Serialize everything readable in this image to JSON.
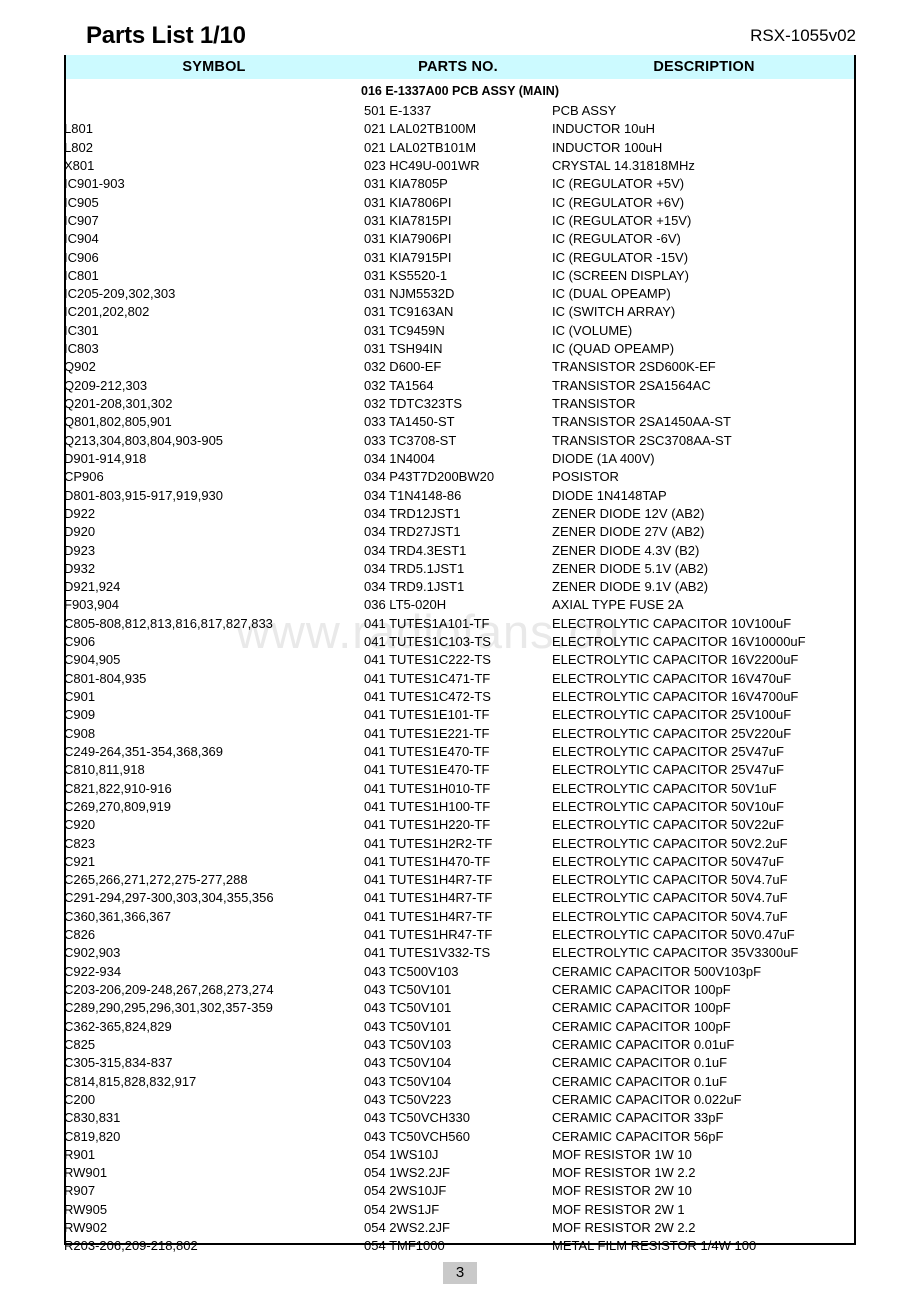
{
  "document": {
    "title": "Parts List 1/10",
    "model": "RSX-1055v02",
    "page_number": "3",
    "watermark": "www.radiofans.cn"
  },
  "table": {
    "columns": [
      "SYMBOL",
      "PARTS NO.",
      "DESCRIPTION"
    ],
    "section_header": "016 E-1337A00 PCB ASSY (MAIN)",
    "rows": [
      {
        "symbol": "",
        "part": "501 E-1337",
        "desc": "PCB ASSY"
      },
      {
        "symbol": "L801",
        "part": "021 LAL02TB100M",
        "desc": "INDUCTOR 10uH"
      },
      {
        "symbol": "L802",
        "part": "021 LAL02TB101M",
        "desc": "INDUCTOR 100uH"
      },
      {
        "symbol": "X801",
        "part": "023 HC49U-001WR",
        "desc": "CRYSTAL 14.31818MHz"
      },
      {
        "symbol": "IC901-903",
        "part": "031 KIA7805P",
        "desc": "IC (REGULATOR    +5V)"
      },
      {
        "symbol": "IC905",
        "part": "031 KIA7806PI",
        "desc": "IC (REGULATOR    +6V)"
      },
      {
        "symbol": "IC907",
        "part": "031 KIA7815PI",
        "desc": "IC (REGULATOR  +15V)"
      },
      {
        "symbol": "IC904",
        "part": "031 KIA7906PI",
        "desc": "IC (REGULATOR    -6V)"
      },
      {
        "symbol": "IC906",
        "part": "031 KIA7915PI",
        "desc": "IC (REGULATOR  -15V)"
      },
      {
        "symbol": "IC801",
        "part": "031 KS5520-1",
        "desc": "IC (SCREEN DISPLAY)"
      },
      {
        "symbol": "IC205-209,302,303",
        "part": "031 NJM5532D",
        "desc": "IC (DUAL OPEAMP)"
      },
      {
        "symbol": "IC201,202,802",
        "part": "031 TC9163AN",
        "desc": "IC (SWITCH ARRAY)"
      },
      {
        "symbol": "IC301",
        "part": "031 TC9459N",
        "desc": "IC (VOLUME)"
      },
      {
        "symbol": "IC803",
        "part": "031 TSH94IN",
        "desc": "IC (QUAD OPEAMP)"
      },
      {
        "symbol": "Q902",
        "part": "032 D600-EF",
        "desc": "TRANSISTOR 2SD600K-EF"
      },
      {
        "symbol": "Q209-212,303",
        "part": "032 TA1564",
        "desc": "TRANSISTOR 2SA1564AC"
      },
      {
        "symbol": "Q201-208,301,302",
        "part": "032 TDTC323TS",
        "desc": "TRANSISTOR"
      },
      {
        "symbol": "Q801,802,805,901",
        "part": "033 TA1450-ST",
        "desc": "TRANSISTOR 2SA1450AA-ST"
      },
      {
        "symbol": "Q213,304,803,804,903-905",
        "part": "033 TC3708-ST",
        "desc": "TRANSISTOR 2SC3708AA-ST"
      },
      {
        "symbol": "D901-914,918",
        "part": "034 1N4004",
        "desc": "DIODE (1A 400V)"
      },
      {
        "symbol": "CP906",
        "part": "034 P43T7D200BW20",
        "desc": "POSISTOR"
      },
      {
        "symbol": "D801-803,915-917,919,930",
        "part": "034 T1N4148-86",
        "desc": "DIODE 1N4148TAP"
      },
      {
        "symbol": "D922",
        "part": "034 TRD12JST1",
        "desc": "ZENER DIODE 12V (AB2)"
      },
      {
        "symbol": "D920",
        "part": "034 TRD27JST1",
        "desc": "ZENER DIODE 27V (AB2)"
      },
      {
        "symbol": "D923",
        "part": "034 TRD4.3EST1",
        "desc": "ZENER DIODE 4.3V  (B2)"
      },
      {
        "symbol": "D932",
        "part": "034 TRD5.1JST1",
        "desc": "ZENER DIODE 5.1V (AB2)"
      },
      {
        "symbol": "D921,924",
        "part": "034 TRD9.1JST1",
        "desc": "ZENER DIODE 9.1V (AB2)"
      },
      {
        "symbol": "F903,904",
        "part": "036 LT5-020H",
        "desc": "AXIAL TYPE FUSE 2A"
      },
      {
        "symbol": "C805-808,812,813,816,817,827,833",
        "part": "041 TUTES1A101-TF",
        "desc": "ELECTROLYTIC CAPACITOR 10V100uF"
      },
      {
        "symbol": "C906",
        "part": "041 TUTES1C103-TS",
        "desc": "ELECTROLYTIC CAPACITOR 16V10000uF"
      },
      {
        "symbol": "C904,905",
        "part": "041 TUTES1C222-TS",
        "desc": "ELECTROLYTIC CAPACITOR 16V2200uF"
      },
      {
        "symbol": "C801-804,935",
        "part": "041 TUTES1C471-TF",
        "desc": "ELECTROLYTIC CAPACITOR 16V470uF"
      },
      {
        "symbol": "C901",
        "part": "041 TUTES1C472-TS",
        "desc": "ELECTROLYTIC CAPACITOR 16V4700uF"
      },
      {
        "symbol": "C909",
        "part": "041 TUTES1E101-TF",
        "desc": "ELECTROLYTIC CAPACITOR 25V100uF"
      },
      {
        "symbol": "C908",
        "part": "041 TUTES1E221-TF",
        "desc": "ELECTROLYTIC CAPACITOR 25V220uF"
      },
      {
        "symbol": "C249-264,351-354,368,369",
        "part": "041 TUTES1E470-TF",
        "desc": "ELECTROLYTIC CAPACITOR 25V47uF"
      },
      {
        "symbol": "C810,811,918",
        "part": "041 TUTES1E470-TF",
        "desc": "ELECTROLYTIC CAPACITOR 25V47uF"
      },
      {
        "symbol": "C821,822,910-916",
        "part": "041 TUTES1H010-TF",
        "desc": "ELECTROLYTIC CAPACITOR 50V1uF"
      },
      {
        "symbol": "C269,270,809,919",
        "part": "041 TUTES1H100-TF",
        "desc": "ELECTROLYTIC CAPACITOR 50V10uF"
      },
      {
        "symbol": "C920",
        "part": "041 TUTES1H220-TF",
        "desc": "ELECTROLYTIC CAPACITOR 50V22uF"
      },
      {
        "symbol": "C823",
        "part": "041 TUTES1H2R2-TF",
        "desc": "ELECTROLYTIC CAPACITOR 50V2.2uF"
      },
      {
        "symbol": "C921",
        "part": "041 TUTES1H470-TF",
        "desc": "ELECTROLYTIC CAPACITOR 50V47uF"
      },
      {
        "symbol": "C265,266,271,272,275-277,288",
        "part": "041 TUTES1H4R7-TF",
        "desc": "ELECTROLYTIC CAPACITOR 50V4.7uF"
      },
      {
        "symbol": "C291-294,297-300,303,304,355,356",
        "part": "041 TUTES1H4R7-TF",
        "desc": "ELECTROLYTIC CAPACITOR 50V4.7uF"
      },
      {
        "symbol": "C360,361,366,367",
        "part": "041 TUTES1H4R7-TF",
        "desc": "ELECTROLYTIC CAPACITOR 50V4.7uF"
      },
      {
        "symbol": "C826",
        "part": "041 TUTES1HR47-TF",
        "desc": "ELECTROLYTIC CAPACITOR 50V0.47uF"
      },
      {
        "symbol": "C902,903",
        "part": "041 TUTES1V332-TS",
        "desc": "ELECTROLYTIC CAPACITOR 35V3300uF"
      },
      {
        "symbol": "C922-934",
        "part": "043 TC500V103",
        "desc": "CERAMIC CAPACITOR 500V103pF"
      },
      {
        "symbol": "C203-206,209-248,267,268,273,274",
        "part": "043 TC50V101",
        "desc": "CERAMIC CAPACITOR 100pF"
      },
      {
        "symbol": "C289,290,295,296,301,302,357-359",
        "part": "043 TC50V101",
        "desc": "CERAMIC CAPACITOR 100pF"
      },
      {
        "symbol": "C362-365,824,829",
        "part": "043 TC50V101",
        "desc": "CERAMIC CAPACITOR 100pF"
      },
      {
        "symbol": "C825",
        "part": "043 TC50V103",
        "desc": "CERAMIC CAPACITOR 0.01uF"
      },
      {
        "symbol": "C305-315,834-837",
        "part": "043 TC50V104",
        "desc": "CERAMIC CAPACITOR 0.1uF"
      },
      {
        "symbol": "C814,815,828,832,917",
        "part": "043 TC50V104",
        "desc": "CERAMIC CAPACITOR 0.1uF"
      },
      {
        "symbol": "C200",
        "part": "043 TC50V223",
        "desc": "CERAMIC CAPACITOR 0.022uF"
      },
      {
        "symbol": "C830,831",
        "part": "043 TC50VCH330",
        "desc": "CERAMIC CAPACITOR 33pF"
      },
      {
        "symbol": "C819,820",
        "part": "043 TC50VCH560",
        "desc": "CERAMIC CAPACITOR 56pF"
      },
      {
        "symbol": "R901",
        "part": "054 1WS10J",
        "desc": "MOF RESISTOR 1W 10"
      },
      {
        "symbol": "RW901",
        "part": "054 1WS2.2JF",
        "desc": "MOF RESISTOR 1W 2.2"
      },
      {
        "symbol": "R907",
        "part": "054 2WS10JF",
        "desc": "MOF RESISTOR 2W 10"
      },
      {
        "symbol": "RW905",
        "part": "054 2WS1JF",
        "desc": "MOF RESISTOR 2W 1"
      },
      {
        "symbol": "RW902",
        "part": "054 2WS2.2JF",
        "desc": "MOF RESISTOR 2W 2.2"
      },
      {
        "symbol": "R203-206,209-218,802",
        "part": "054 TMF1000",
        "desc": "METAL FILM RESISTOR 1/4W 100"
      }
    ]
  }
}
